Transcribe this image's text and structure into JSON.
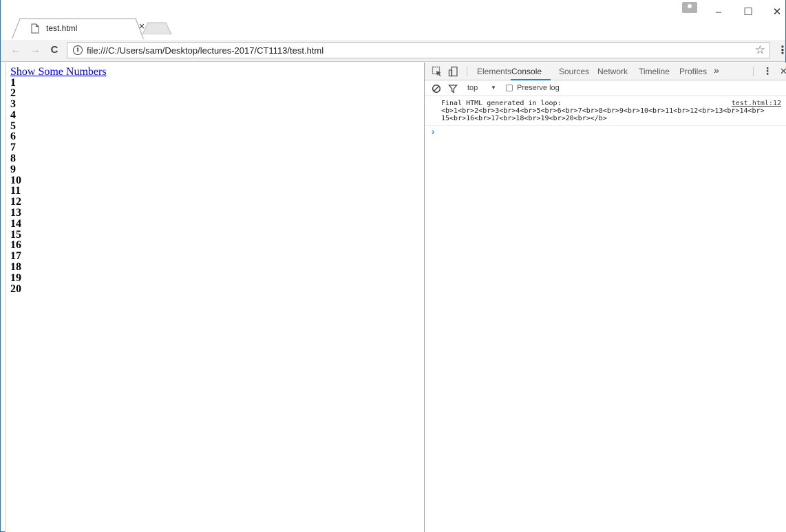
{
  "browser": {
    "tab": {
      "title": "test.html",
      "close_glyph": "×"
    },
    "window_controls": {
      "minimize": "–",
      "maximize": "☐",
      "close": "✕"
    },
    "nav": {
      "back": "←",
      "forward": "→",
      "reload": "C"
    },
    "address": {
      "info_glyph": "i",
      "url": "file:///C:/Users/sam/Desktop/lectures-2017/CT1113/test.html",
      "star_glyph": "☆"
    },
    "menu_glyph": "⋮"
  },
  "page": {
    "link_label": "Show Some Numbers",
    "numbers": [
      "1",
      "2",
      "3",
      "4",
      "5",
      "6",
      "7",
      "8",
      "9",
      "10",
      "11",
      "12",
      "13",
      "14",
      "15",
      "16",
      "17",
      "18",
      "19",
      "20"
    ]
  },
  "devtools": {
    "tabs": [
      {
        "label": "Elements",
        "active": false
      },
      {
        "label": "Console",
        "active": true
      },
      {
        "label": "Sources",
        "active": false
      },
      {
        "label": "Network",
        "active": false
      },
      {
        "label": "Timeline",
        "active": false
      },
      {
        "label": "Profiles",
        "active": false
      }
    ],
    "more_tabs_glyph": "»",
    "menu_glyph": "⋮",
    "close_glyph": "✕",
    "filter": {
      "context": "top",
      "dropdown_glyph": "▼",
      "preserve_log_label": "Preserve log",
      "preserve_log_checked": false
    },
    "console": {
      "entries": [
        {
          "message": "Final HTML generated in loop:\n<b>1<br>2<br>3<br>4<br>5<br>6<br>7<br>8<br>9<br>10<br>11<br>12<br>13<br>14<br>15<br>16<br>17<br>18<br>19<br>20<br></b>",
          "source": "test.html:12"
        }
      ],
      "prompt_glyph": "›"
    }
  },
  "colors": {
    "accent": "#3879d9",
    "link": "#0000ee",
    "frame": "#2b73b9"
  }
}
